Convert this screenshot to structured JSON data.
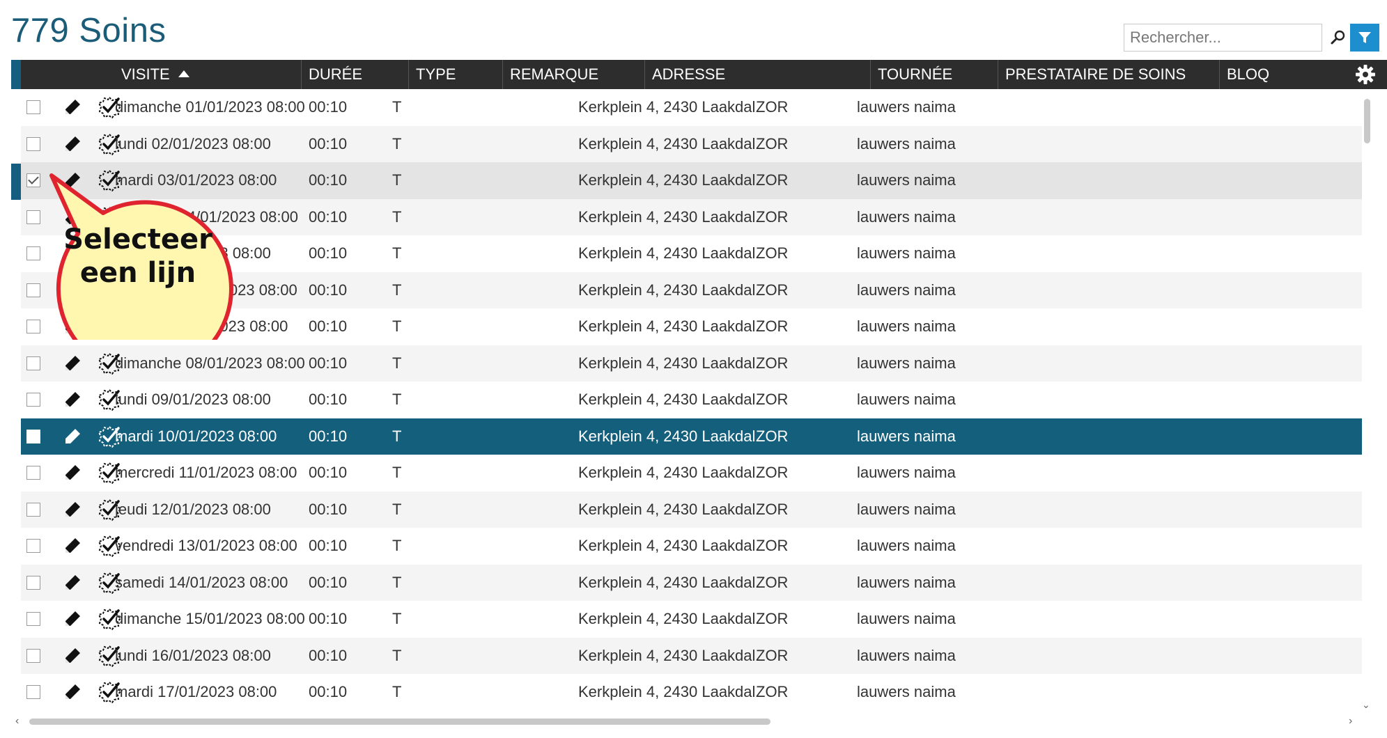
{
  "page": {
    "title": "779 Soins"
  },
  "search": {
    "placeholder": "Rechercher..."
  },
  "grid": {
    "columns": [
      "VISITE",
      "DURÉE",
      "TYPE",
      "REMARQUE",
      "ADRESSE",
      "TOURNÉE",
      "PRESTATAIRE DE SOINS",
      "BLOQ"
    ],
    "sorted_column": "VISITE",
    "sort_direction": "ascending",
    "rows": [
      {
        "visite": "dimanche 01/01/2023 08:00",
        "duree": "00:10",
        "type": "T",
        "remarque": "",
        "adresse": "Kerkplein 4, 2430 Laakdal",
        "tournee": "ZOR",
        "prestataire": "lauwers naima",
        "checked": false,
        "state": "normal"
      },
      {
        "visite": "lundi 02/01/2023 08:00",
        "duree": "00:10",
        "type": "T",
        "remarque": "",
        "adresse": "Kerkplein 4, 2430 Laakdal",
        "tournee": "ZOR",
        "prestataire": "lauwers naima",
        "checked": false,
        "state": "alt"
      },
      {
        "visite": "mardi 03/01/2023 08:00",
        "duree": "00:10",
        "type": "T",
        "remarque": "",
        "adresse": "Kerkplein 4, 2430 Laakdal",
        "tournee": "ZOR",
        "prestataire": "lauwers naima",
        "checked": true,
        "state": "grey"
      },
      {
        "visite": "mercredi 04/01/2023 08:00",
        "duree": "00:10",
        "type": "T",
        "remarque": "",
        "adresse": "Kerkplein 4, 2430 Laakdal",
        "tournee": "ZOR",
        "prestataire": "lauwers naima",
        "checked": false,
        "state": "alt"
      },
      {
        "visite": "jeudi 05/01/2023 08:00",
        "duree": "00:10",
        "type": "T",
        "remarque": "",
        "adresse": "Kerkplein 4, 2430 Laakdal",
        "tournee": "ZOR",
        "prestataire": "lauwers naima",
        "checked": false,
        "state": "normal"
      },
      {
        "visite": "vendredi 06/01/2023 08:00",
        "duree": "00:10",
        "type": "T",
        "remarque": "",
        "adresse": "Kerkplein 4, 2430 Laakdal",
        "tournee": "ZOR",
        "prestataire": "lauwers naima",
        "checked": false,
        "state": "alt"
      },
      {
        "visite": "samedi 07/01/2023 08:00",
        "duree": "00:10",
        "type": "T",
        "remarque": "",
        "adresse": "Kerkplein 4, 2430 Laakdal",
        "tournee": "ZOR",
        "prestataire": "lauwers naima",
        "checked": false,
        "state": "normal"
      },
      {
        "visite": "dimanche 08/01/2023 08:00",
        "duree": "00:10",
        "type": "T",
        "remarque": "",
        "adresse": "Kerkplein 4, 2430 Laakdal",
        "tournee": "ZOR",
        "prestataire": "lauwers naima",
        "checked": false,
        "state": "alt"
      },
      {
        "visite": "lundi 09/01/2023 08:00",
        "duree": "00:10",
        "type": "T",
        "remarque": "",
        "adresse": "Kerkplein 4, 2430 Laakdal",
        "tournee": "ZOR",
        "prestataire": "lauwers naima",
        "checked": false,
        "state": "normal"
      },
      {
        "visite": "mardi 10/01/2023 08:00",
        "duree": "00:10",
        "type": "T",
        "remarque": "",
        "adresse": "Kerkplein 4, 2430 Laakdal",
        "tournee": "ZOR",
        "prestataire": "lauwers naima",
        "checked": false,
        "state": "selected"
      },
      {
        "visite": "mercredi 11/01/2023 08:00",
        "duree": "00:10",
        "type": "T",
        "remarque": "",
        "adresse": "Kerkplein 4, 2430 Laakdal",
        "tournee": "ZOR",
        "prestataire": "lauwers naima",
        "checked": false,
        "state": "normal"
      },
      {
        "visite": "jeudi 12/01/2023 08:00",
        "duree": "00:10",
        "type": "T",
        "remarque": "",
        "adresse": "Kerkplein 4, 2430 Laakdal",
        "tournee": "ZOR",
        "prestataire": "lauwers naima",
        "checked": false,
        "state": "alt"
      },
      {
        "visite": "vendredi 13/01/2023 08:00",
        "duree": "00:10",
        "type": "T",
        "remarque": "",
        "adresse": "Kerkplein 4, 2430 Laakdal",
        "tournee": "ZOR",
        "prestataire": "lauwers naima",
        "checked": false,
        "state": "normal"
      },
      {
        "visite": "samedi 14/01/2023 08:00",
        "duree": "00:10",
        "type": "T",
        "remarque": "",
        "adresse": "Kerkplein 4, 2430 Laakdal",
        "tournee": "ZOR",
        "prestataire": "lauwers naima",
        "checked": false,
        "state": "alt"
      },
      {
        "visite": "dimanche 15/01/2023 08:00",
        "duree": "00:10",
        "type": "T",
        "remarque": "",
        "adresse": "Kerkplein 4, 2430 Laakdal",
        "tournee": "ZOR",
        "prestataire": "lauwers naima",
        "checked": false,
        "state": "normal"
      },
      {
        "visite": "lundi 16/01/2023 08:00",
        "duree": "00:10",
        "type": "T",
        "remarque": "",
        "adresse": "Kerkplein 4, 2430 Laakdal",
        "tournee": "ZOR",
        "prestataire": "lauwers naima",
        "checked": false,
        "state": "alt"
      },
      {
        "visite": "mardi 17/01/2023 08:00",
        "duree": "00:10",
        "type": "T",
        "remarque": "",
        "adresse": "Kerkplein 4, 2430 Laakdal",
        "tournee": "ZOR",
        "prestataire": "lauwers naima",
        "checked": false,
        "state": "normal"
      }
    ]
  },
  "icons": {
    "row_edit": "pencil-icon",
    "row_validate": "checkmark-badge-icon",
    "search": "search-icon",
    "filter": "filter-icon",
    "settings": "gear-icon"
  },
  "callout": {
    "line1": "Selecteer",
    "line2": "een lijn"
  },
  "colors": {
    "title": "#1b5c78",
    "header_bg": "#2d2d2d",
    "selected_row": "#145f7c",
    "filter_button": "#1e8fce",
    "callout_fill": "#fff7b0",
    "callout_border": "#e0242f"
  }
}
